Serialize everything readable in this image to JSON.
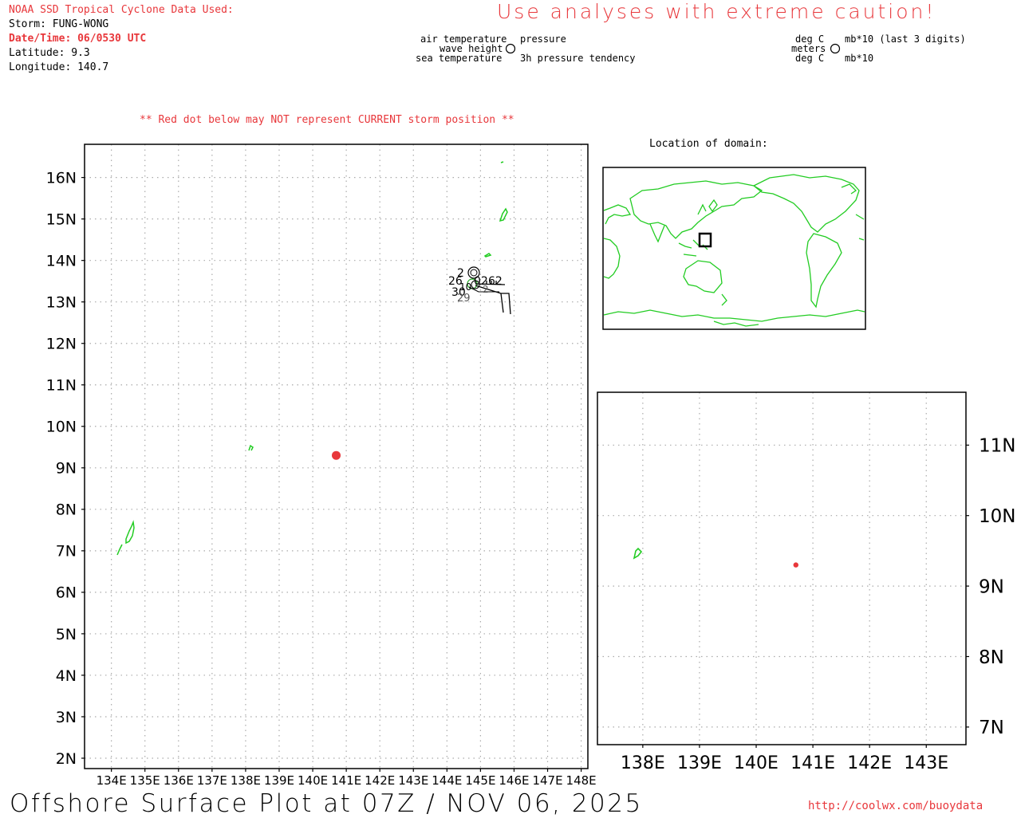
{
  "header": {
    "source": "NOAA SSD Tropical Cyclone Data Used:",
    "storm": "Storm: FUNG-WONG",
    "datetime": "Date/Time: 06/0530 UTC",
    "latitude": "Latitude: 9.3",
    "longitude": "Longitude: 140.7",
    "caution": "Use analyses with extreme caution!",
    "red_dot_note": "** Red dot below may NOT represent CURRENT storm position **",
    "inset_title": "Location of domain:"
  },
  "legend": {
    "left": {
      "top_left": "air temperature",
      "top_right": "pressure",
      "mid": "wave height",
      "bottom_left": "sea temperature",
      "bottom_right": "3h pressure tendency"
    },
    "right": {
      "top_left": "deg C",
      "top_right": "mb*10 (last 3 digits)",
      "mid": "meters",
      "bottom_left": "deg C",
      "bottom_right": "mb*10"
    }
  },
  "footer": {
    "title": "Offshore Surface Plot at 07Z / NOV 06, 2025",
    "url": "http://coolwx.com/buoydata"
  },
  "main_map": {
    "lat_labels": [
      "2N",
      "3N",
      "4N",
      "5N",
      "6N",
      "7N",
      "8N",
      "9N",
      "10N",
      "11N",
      "12N",
      "13N",
      "14N",
      "15N",
      "16N"
    ],
    "lon_labels": [
      "134E",
      "135E",
      "136E",
      "137E",
      "138E",
      "139E",
      "140E",
      "141E",
      "142E",
      "143E",
      "144E",
      "145E",
      "146E",
      "147E",
      "148E"
    ],
    "lat_range": [
      1.75,
      16.8
    ],
    "lon_range": [
      133.2,
      148.2
    ],
    "storm": {
      "lat": 9.3,
      "lon": 140.7
    },
    "station_labels": [
      "2",
      "26",
      "02",
      "62",
      "30",
      "29",
      "10",
      "2"
    ]
  },
  "zoom_map": {
    "lat_labels": [
      "7N",
      "8N",
      "9N",
      "10N",
      "11N"
    ],
    "lon_labels": [
      "138E",
      "139E",
      "140E",
      "141E",
      "142E",
      "143E"
    ],
    "lat_range": [
      6.75,
      11.75
    ],
    "lon_range": [
      137.2,
      143.7
    ],
    "storm": {
      "lat": 9.3,
      "lon": 140.7
    }
  },
  "colors": {
    "storm_dot": "#e8373b",
    "coastline": "#22cc22",
    "text_red": "#e8373b",
    "grid": "#aaaaaa"
  }
}
